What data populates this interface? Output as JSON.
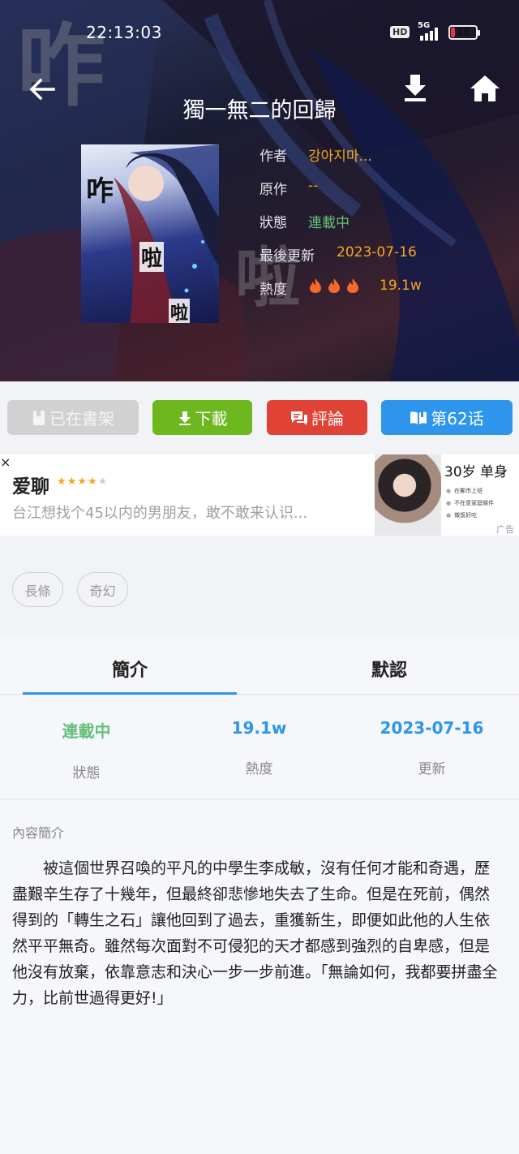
{
  "status_bar": {
    "time": "22:13:03",
    "hd": "HD",
    "network": "5G",
    "battery": "15",
    "battery_level": 0.15
  },
  "header": {
    "title": "獨一無二的回歸",
    "back_icon": "arrow-left-icon",
    "download_icon": "download-icon",
    "home_icon": "home-icon",
    "cover_text": [
      "咋",
      "啦",
      "啦"
    ]
  },
  "info": {
    "author_label": "作者",
    "author": "강아지마...",
    "origin_label": "原作",
    "origin": "--",
    "status_label": "狀態",
    "status": "連載中",
    "updated_label": "最後更新",
    "updated": "2023-07-16",
    "heat_label": "熱度",
    "heat_flames": 3,
    "heat": "19.1w"
  },
  "actions": {
    "shelf": "已在書架",
    "download": "下載",
    "comment": "評論",
    "chapter": "第62话"
  },
  "ad": {
    "name": "爱聊",
    "rating": 4,
    "description": "台江想找个45以内的男朋友，敢不敢来认识...",
    "promo_title": "30岁 单身",
    "promo_lines": [
      "在郵市上班",
      "不在意家庭條件",
      "做饭好吃"
    ],
    "ad_label": "广告",
    "close": "×"
  },
  "tags": [
    "長條",
    "奇幻"
  ],
  "tabs": [
    "簡介",
    "默認"
  ],
  "stats": [
    {
      "value": "連載中",
      "label": "狀態"
    },
    {
      "value": "19.1w",
      "label": "熱度"
    },
    {
      "value": "2023-07-16",
      "label": "更新"
    }
  ],
  "synopsis": {
    "title": "內容簡介",
    "text": "被這個世界召喚的平凡的中學生李成敏，沒有任何才能和奇遇，歷盡艱辛生存了十幾年，但最終卻悲慘地失去了生命。但是在死前，偶然得到的「轉生之石」讓他回到了過去，重獲新生，即便如此他的人生依然平平無奇。雖然每次面對不可侵犯的天才都感到強烈的自卑感，但是他沒有放棄，依靠意志和決心一步一步前進。「無論如何，我都要拼盡全力，比前世過得更好!」"
  },
  "colors": {
    "accent_blue": "#2d96ec",
    "green": "#6cb81e",
    "red": "#e14236",
    "orange": "#f5a623",
    "status_green": "#64c07a"
  }
}
